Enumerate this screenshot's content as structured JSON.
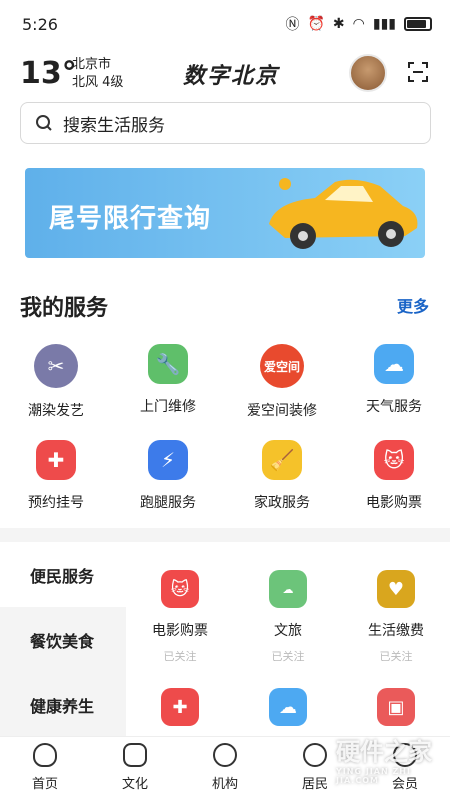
{
  "status": {
    "time": "5:26"
  },
  "header": {
    "temperature": "13°",
    "city": "北京市",
    "wind": "北风  4级",
    "logo": "数字北京"
  },
  "search": {
    "placeholder": "搜索生活服务"
  },
  "banner": {
    "text": "尾号限行查询"
  },
  "my_services": {
    "title": "我的服务",
    "more": "更多",
    "items": [
      {
        "label": "潮染发艺",
        "icon": "salon-icon",
        "color": "#7a7aa8"
      },
      {
        "label": "上门维修",
        "icon": "wrench-icon",
        "color": "#5fbf6a"
      },
      {
        "label": "爱空间装修",
        "icon": "aikongjian-icon",
        "color": "#e84a2e"
      },
      {
        "label": "天气服务",
        "icon": "weather-icon",
        "color": "#4da9f2"
      },
      {
        "label": "预约挂号",
        "icon": "medical-cross-icon",
        "color": "#ee4b4b"
      },
      {
        "label": "跑腿服务",
        "icon": "lightning-icon",
        "color": "#3d7bea"
      },
      {
        "label": "家政服务",
        "icon": "broom-icon",
        "color": "#f5c22a"
      },
      {
        "label": "电影购票",
        "icon": "movie-cat-icon",
        "color": "#f04a4a"
      }
    ]
  },
  "categories": {
    "items": [
      "便民服务",
      "餐饮美食",
      "健康养生"
    ]
  },
  "category_services": [
    {
      "label": "电影购票",
      "sub": "已关注",
      "icon": "movie-cat-icon",
      "color": "#f04a4a"
    },
    {
      "label": "文旅",
      "sub": "已关注",
      "icon": "cloud-icon",
      "color": "#6cc47a"
    },
    {
      "label": "生活缴费",
      "sub": "已关注",
      "icon": "heart-pay-icon",
      "color": "#d9a61e"
    },
    {
      "label": "",
      "sub": "",
      "icon": "medical-cross-icon",
      "color": "#ee4b4b"
    },
    {
      "label": "",
      "sub": "",
      "icon": "weather-icon",
      "color": "#4da9f2"
    },
    {
      "label": "",
      "sub": "",
      "icon": "box-icon",
      "color": "#ea5a5a"
    }
  ],
  "tabs": [
    {
      "label": "首页",
      "icon": "home-icon"
    },
    {
      "label": "文化",
      "icon": "culture-icon"
    },
    {
      "label": "机构",
      "icon": "phone-icon"
    },
    {
      "label": "居民",
      "icon": "resident-icon"
    },
    {
      "label": "会员",
      "icon": "member-icon"
    }
  ],
  "watermark": {
    "text": "硬件之家",
    "sub": "YING JIAN ZHI JIA.COM"
  }
}
